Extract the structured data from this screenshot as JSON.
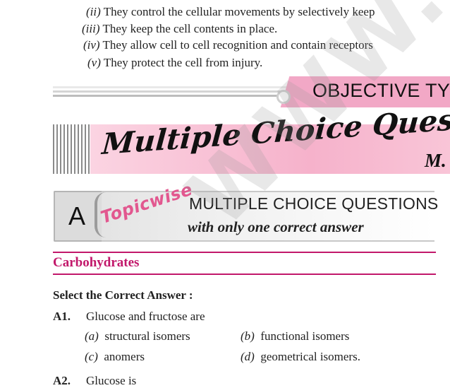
{
  "list": {
    "items": [
      {
        "num": "(ii)",
        "text": "They control the cellular movements by selectively keep"
      },
      {
        "num": "(iii)",
        "text": "They keep the cell contents in place."
      },
      {
        "num": "(iv)",
        "text": "They allow cell to cell recognition and contain receptors"
      },
      {
        "num": "(v)",
        "text": "They protect the cell from injury."
      }
    ]
  },
  "objective_banner": {
    "title": "OBJECTIVE TY"
  },
  "mcq_banner": {
    "title": "Multiple Choice Questions",
    "abbr": "M."
  },
  "section_a": {
    "letter": "A",
    "tag": "Topicwise",
    "main": "MULTIPLE CHOICE QUESTIONS",
    "sub": "with only one correct answer"
  },
  "section": {
    "title": "Carbohydrates"
  },
  "instruction": "Select the Correct Answer :",
  "questions": [
    {
      "num": "A1.",
      "text": "Glucose and fructose are",
      "options": [
        {
          "label": "(a)",
          "text": "structural isomers"
        },
        {
          "label": "(b)",
          "text": "functional isomers"
        },
        {
          "label": "(c)",
          "text": "anomers"
        },
        {
          "label": "(d)",
          "text": "geometrical isomers."
        }
      ]
    },
    {
      "num": "A2.",
      "text": "Glucose is",
      "options": []
    }
  ],
  "watermark": "WWW.JEE",
  "colors": {
    "accent": "#c2186b",
    "pink_band": "#f6b2cb",
    "topicwise": "#e2578f"
  }
}
